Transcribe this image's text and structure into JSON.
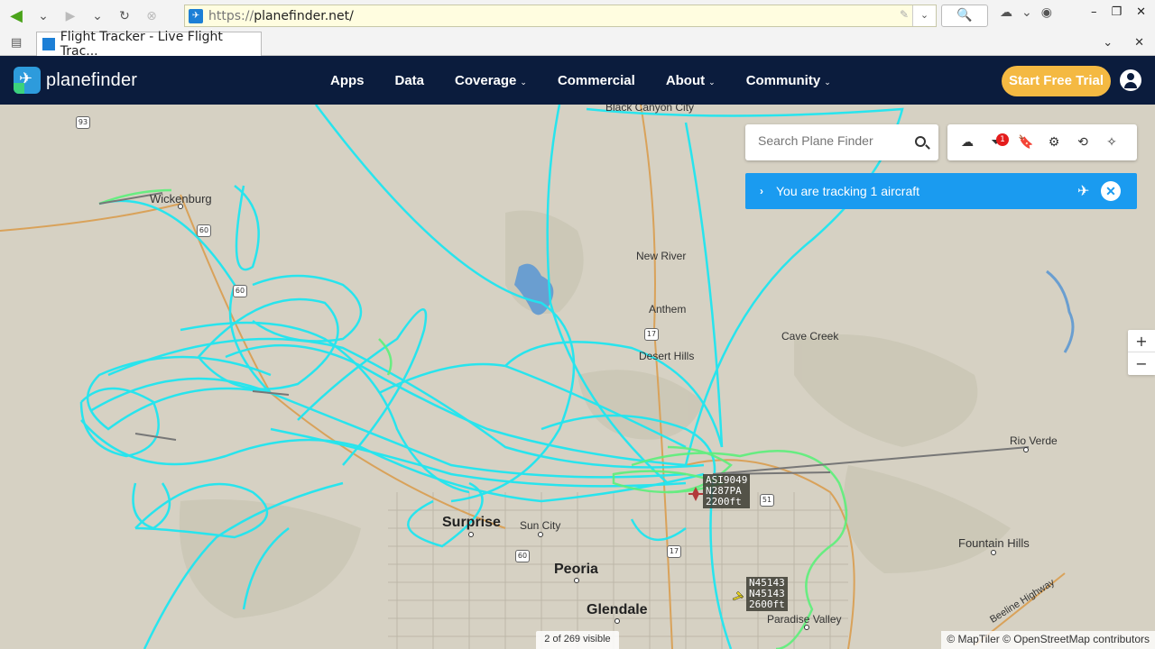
{
  "browser": {
    "url_proto": "https://",
    "url_host": "planefinder.net/",
    "tab_title": "Flight Tracker - Live Flight Trac..."
  },
  "nav": {
    "brand": "planefinder",
    "links": [
      "Apps",
      "Data",
      "Coverage",
      "Commercial",
      "About",
      "Community"
    ],
    "trial_button": "Start Free Trial"
  },
  "search": {
    "placeholder": "Search Plane Finder"
  },
  "tools": {
    "filter_badge": "1"
  },
  "tracking": {
    "text": "You are tracking 1 aircraft"
  },
  "zoom": {
    "in": "+",
    "out": "−"
  },
  "map": {
    "places": [
      {
        "name": "Black Canyon City"
      },
      {
        "name": "Wickenburg"
      },
      {
        "name": "New River"
      },
      {
        "name": "Anthem"
      },
      {
        "name": "Cave Creek"
      },
      {
        "name": "Desert Hills"
      },
      {
        "name": "Rio Verde"
      },
      {
        "name": "Surprise"
      },
      {
        "name": "Sun City"
      },
      {
        "name": "Peoria"
      },
      {
        "name": "Fountain Hills"
      },
      {
        "name": "Glendale"
      },
      {
        "name": "Paradise Valley"
      }
    ],
    "shields": [
      "93",
      "60",
      "60",
      "17",
      "51",
      "17",
      "60"
    ],
    "road_label": "Beeline Highway"
  },
  "aircraft": [
    {
      "lines": [
        "ASI9049",
        "N287PA",
        "2200ft"
      ]
    },
    {
      "lines": [
        "N45143",
        "N45143",
        "2600ft"
      ]
    }
  ],
  "footer": {
    "visible_count": "2 of 269 visible",
    "attribution": "© MapTiler © OpenStreetMap contributors"
  },
  "colors": {
    "track": "#1fe6f0",
    "track_green": "#5cf07a",
    "nav_bg": "#0b1c3d",
    "trial": "#f4b942",
    "tracking_bar": "#1a9bf0"
  }
}
